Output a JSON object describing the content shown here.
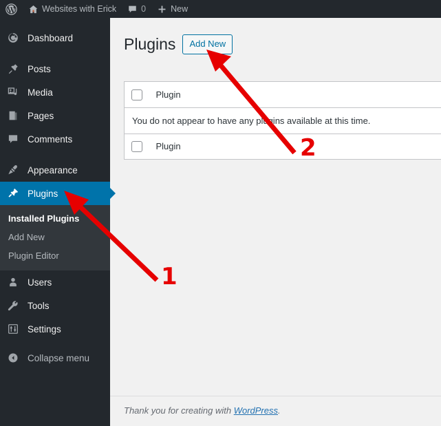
{
  "adminbar": {
    "items": [
      {
        "name": "wordpress-logo",
        "icon": "wordpress-logo-icon",
        "label": ""
      },
      {
        "name": "site-name",
        "icon": "home-icon",
        "label": "Websites with Erick"
      },
      {
        "name": "comments",
        "icon": "comment-bubble-icon",
        "label": "0"
      },
      {
        "name": "new-content",
        "icon": "plus-icon",
        "label": "New"
      }
    ]
  },
  "sidebar": {
    "items": [
      {
        "label": "Dashboard",
        "icon": "dashboard-icon",
        "current": false
      },
      {
        "label": "Posts",
        "icon": "pin-icon",
        "current": false
      },
      {
        "label": "Media",
        "icon": "media-icon",
        "current": false
      },
      {
        "label": "Pages",
        "icon": "pages-icon",
        "current": false
      },
      {
        "label": "Comments",
        "icon": "comment-bubble-icon",
        "current": false
      },
      {
        "label": "Appearance",
        "icon": "paintbrush-icon",
        "current": false
      },
      {
        "label": "Plugins",
        "icon": "plug-icon",
        "current": true
      },
      {
        "label": "Users",
        "icon": "user-icon",
        "current": false
      },
      {
        "label": "Tools",
        "icon": "wrench-icon",
        "current": false
      },
      {
        "label": "Settings",
        "icon": "sliders-icon",
        "current": false
      }
    ],
    "submenu": [
      {
        "label": "Installed Plugins",
        "current": true
      },
      {
        "label": "Add New",
        "current": false
      },
      {
        "label": "Plugin Editor",
        "current": false
      }
    ],
    "collapse": {
      "label": "Collapse menu",
      "icon": "collapse-arrow-icon"
    }
  },
  "main": {
    "page_title": "Plugins",
    "add_new_label": "Add New",
    "table": {
      "column_header": "Plugin",
      "column_footer": "Plugin",
      "empty_message": "You do not appear to have any plugins available at this time."
    }
  },
  "footer": {
    "text_before": "Thank you for creating with ",
    "link_label": "WordPress",
    "text_after": "."
  },
  "annotations": {
    "markers": [
      {
        "label": "1",
        "points_to": "sidebar-item-plugins"
      },
      {
        "label": "2",
        "points_to": "add-new-button"
      }
    ],
    "color": "#e60000"
  },
  "colors": {
    "sidebar_bg": "#23282d",
    "submenu_bg": "#32373c",
    "accent_blue": "#0073aa",
    "content_bg": "#f1f1f1",
    "annotation_red": "#e60000"
  }
}
